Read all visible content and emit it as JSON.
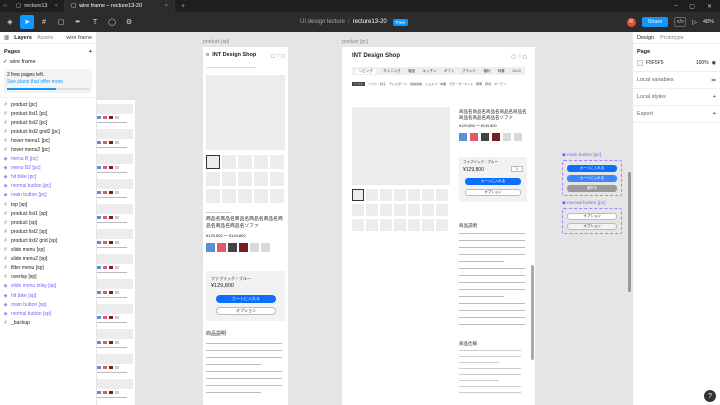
{
  "os_tabs": [
    {
      "label": "recture13",
      "active": false
    },
    {
      "label": "wire frame – recture13-20",
      "active": true
    }
  ],
  "toolbar": {
    "project": "UI design lecture",
    "file": "recture13-20",
    "plan_badge": "Free",
    "avatar_initial": "R",
    "share_label": "Share",
    "dev_icon": "</>",
    "zoom": "48%"
  },
  "left_panel": {
    "tabs": {
      "layers": "Layers",
      "assets": "Assets",
      "page_selector": "wire frame"
    },
    "pages_heading": "Pages",
    "add_page": "+",
    "current_page": "wire frame",
    "upsell_text": "2 free pages left.",
    "upsell_link": "See plans that offer more",
    "upsell_progress": 0.6,
    "layers": [
      {
        "name": "product [pc]",
        "type": "frame"
      },
      {
        "name": "product list1 [pc]",
        "type": "frame"
      },
      {
        "name": "product list2 [pc]",
        "type": "frame"
      },
      {
        "name": "product list2 grid2 [pc]",
        "type": "frame"
      },
      {
        "name": "hover menu1 [pc]",
        "type": "frame"
      },
      {
        "name": "hover menu2 [pc]",
        "type": "frame"
      },
      {
        "name": "menu B [pc]",
        "type": "component"
      },
      {
        "name": "menu B2 [pc]",
        "type": "component"
      },
      {
        "name": "hit bike [pc]",
        "type": "component"
      },
      {
        "name": "normal button [pc]",
        "type": "component"
      },
      {
        "name": "main button [pc]",
        "type": "component"
      },
      {
        "name": "top [sp]",
        "type": "frame"
      },
      {
        "name": "product list1 [sp]",
        "type": "frame"
      },
      {
        "name": "product [sp]",
        "type": "frame"
      },
      {
        "name": "product list2 [sp]",
        "type": "frame"
      },
      {
        "name": "product list2 grid [sp]",
        "type": "frame"
      },
      {
        "name": "slide menu [sp]",
        "type": "frame"
      },
      {
        "name": "slide menu2 [sp]",
        "type": "frame"
      },
      {
        "name": "filter menu [sp]",
        "type": "frame"
      },
      {
        "name": "overlay [sp]",
        "type": "frame"
      },
      {
        "name": "slide menu inlay [sp]",
        "type": "component"
      },
      {
        "name": "hit bike [sp]",
        "type": "component"
      },
      {
        "name": "main button [sp]",
        "type": "component"
      },
      {
        "name": "normal button [sp]",
        "type": "component"
      },
      {
        "name": "_backup",
        "type": "frame"
      }
    ]
  },
  "canvas": {
    "frame_sp_label": "product [sp]",
    "frame_pc_label": "product [pc]",
    "shop_name": "INT Design Shop",
    "product_title": "商品名商品名商品名商品名商品名商品名商品名商品名ソファ",
    "price_range": "¥129,800 ～ ¥149,800",
    "fabric_label": "ファブリック・ブルー",
    "price": "¥129,800",
    "cart_button": "カートに入れる",
    "option_button": "オプション",
    "desc_heading": "商品説明",
    "nav_items": [
      "リビング",
      "ダイニング",
      "寝室",
      "キッチン",
      "ギフト",
      "ブランド",
      "福利",
      "特集",
      "SALE"
    ],
    "sub_nav": [
      "ソファ",
      "ソファ・椅子",
      "テレビボード",
      "収納収納",
      "シェルフ・本棚",
      "ラグ・カーペット",
      "照明",
      "寝具",
      "カーテン"
    ],
    "spec_heading": "商品仕様",
    "main_button_label": "main button [pc]",
    "normal_button_label": "normal button [pc]",
    "btn_cart": "カートに入れる",
    "btn_hover": "カートに入れる",
    "btn_disabled": "選択中",
    "btn_option": "オプション",
    "btn_option2": "オプション",
    "swatch_colors": [
      "#5a8fd8",
      "#e05a67",
      "#444444",
      "#7a1d22",
      "#d9d9d9",
      "#d9d9d9"
    ]
  },
  "right_panel": {
    "tabs": {
      "design": "Design",
      "prototype": "Prototype"
    },
    "page_heading": "Page",
    "bg_hex": "F5F5F5",
    "bg_opacity": "100%",
    "local_variables": "Local variables",
    "local_styles": "Local styles",
    "export": "Export",
    "add": "+"
  }
}
